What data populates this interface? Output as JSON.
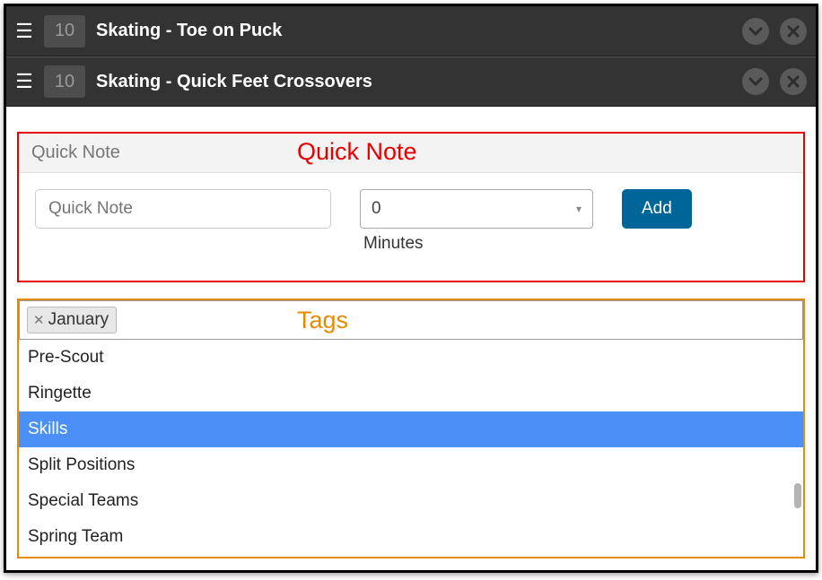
{
  "drills": [
    {
      "num": "10",
      "title": "Skating - Toe on Puck"
    },
    {
      "num": "10",
      "title": "Skating - Quick Feet Crossovers"
    }
  ],
  "quicknote": {
    "header": "Quick Note",
    "placeholder": "Quick Note",
    "minutes_value": "0",
    "minutes_label": "Minutes",
    "add_label": "Add",
    "annotation": "Quick Note"
  },
  "tags": {
    "annotation": "Tags",
    "chips": [
      {
        "label": "January"
      }
    ],
    "options": [
      {
        "label": "Pre-Scout",
        "selected": false
      },
      {
        "label": "Ringette",
        "selected": false
      },
      {
        "label": "Skills",
        "selected": true
      },
      {
        "label": "Split Positions",
        "selected": false
      },
      {
        "label": "Special Teams",
        "selected": false
      },
      {
        "label": "Spring Team",
        "selected": false
      }
    ]
  }
}
